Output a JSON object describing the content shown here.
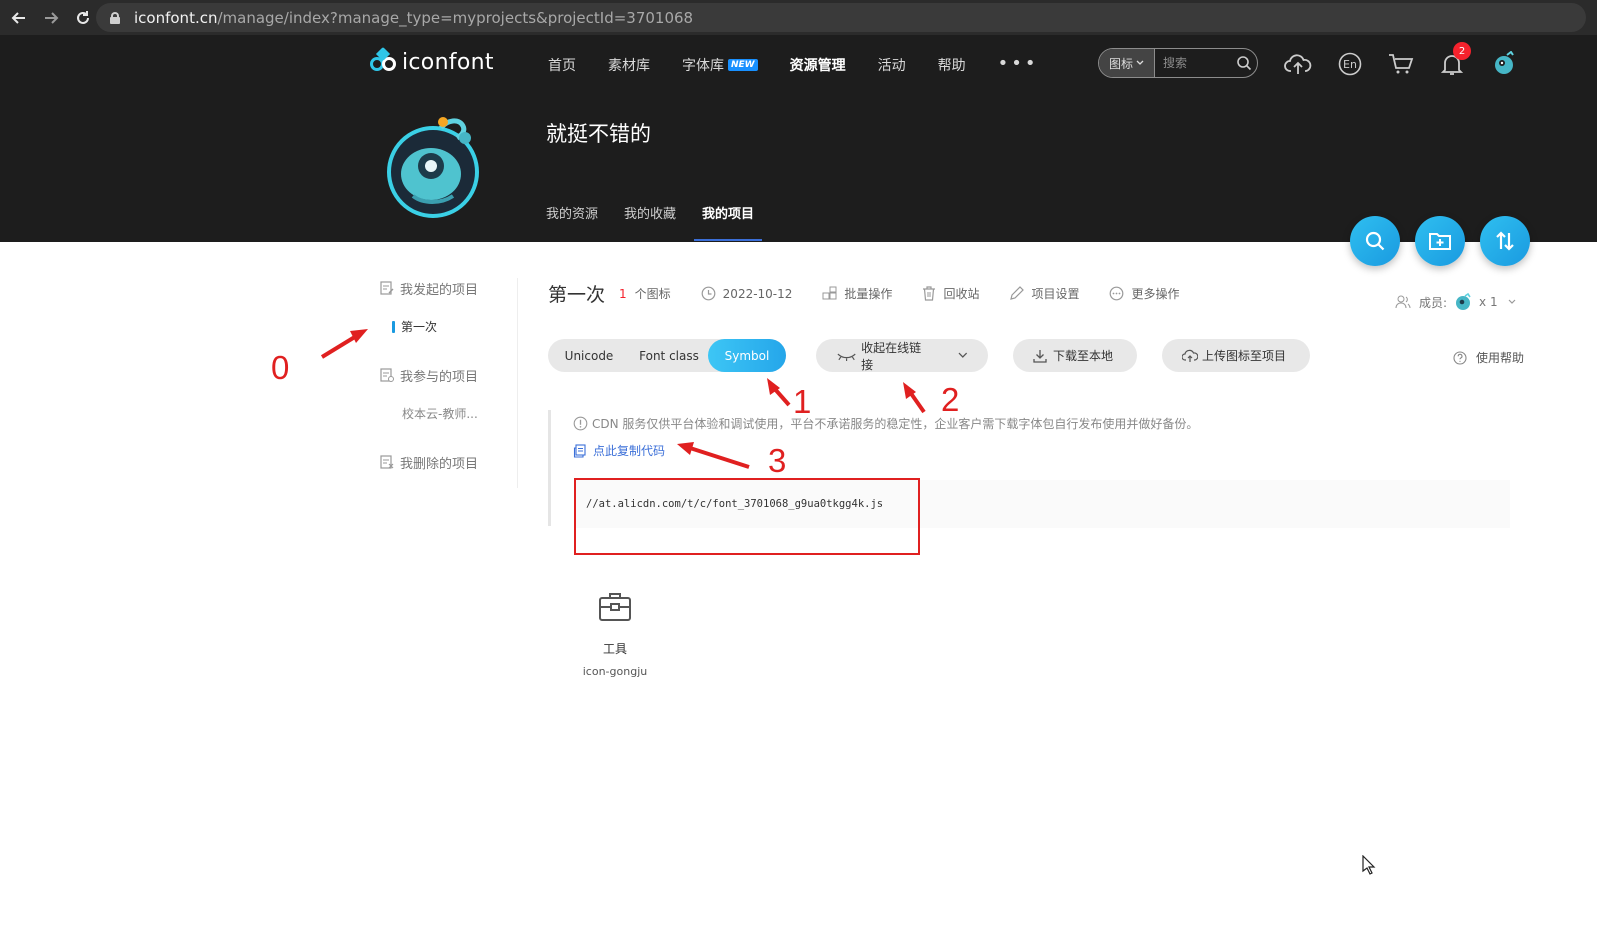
{
  "browser": {
    "url_host": "iconfont.cn",
    "url_path": "/manage/index?manage_type=myprojects&projectId=3701068"
  },
  "header": {
    "logo_text": "iconfont",
    "nav": [
      {
        "label": "首页"
      },
      {
        "label": "素材库"
      },
      {
        "label": "字体库",
        "badge": "NEW"
      },
      {
        "label": "资源管理",
        "active": true
      },
      {
        "label": "活动"
      },
      {
        "label": "帮助"
      }
    ],
    "more": "•••",
    "search": {
      "type": "图标",
      "placeholder": "搜索"
    },
    "notification_count": "2",
    "user_title": "就挺不错的",
    "tabs": [
      {
        "label": "我的资源"
      },
      {
        "label": "我的收藏"
      },
      {
        "label": "我的项目",
        "active": true
      }
    ]
  },
  "sidebar": {
    "started_title": "我发起的项目",
    "started_item": "第一次",
    "joined_title": "我参与的项目",
    "joined_item": "校本云-教师...",
    "deleted_title": "我删除的项目"
  },
  "project": {
    "name": "第一次",
    "count": "1",
    "count_unit": "个图标",
    "date": "2022-10-12",
    "tools": [
      "批量操作",
      "回收站",
      "项目设置",
      "更多操作"
    ],
    "members_label": "成员:",
    "members_count": "x 1"
  },
  "toolbar": {
    "segments": [
      "Unicode",
      "Font class",
      "Symbol"
    ],
    "active_segment": "Symbol",
    "collapse_link": "收起在线链接",
    "download": "下载至本地",
    "upload": "上传图标至项目",
    "help": "使用帮助"
  },
  "cdn": {
    "notice": "CDN 服务仅供平台体验和调试使用，平台不承诺服务的稳定性，企业客户需下载字体包自行发布使用并做好备份。",
    "copy_label": "点此复制代码",
    "code": "//at.alicdn.com/t/c/font_3701068_g9ua0tkgg4k.js"
  },
  "icons": [
    {
      "name": "工具",
      "code": "icon-gongju"
    }
  ],
  "annotations": [
    "0",
    "1",
    "2",
    "3"
  ],
  "colors": {
    "accent": "#25a6ea",
    "link": "#3b6fd8",
    "annotation": "#e02020",
    "header_bg": "#1d1d1d"
  }
}
